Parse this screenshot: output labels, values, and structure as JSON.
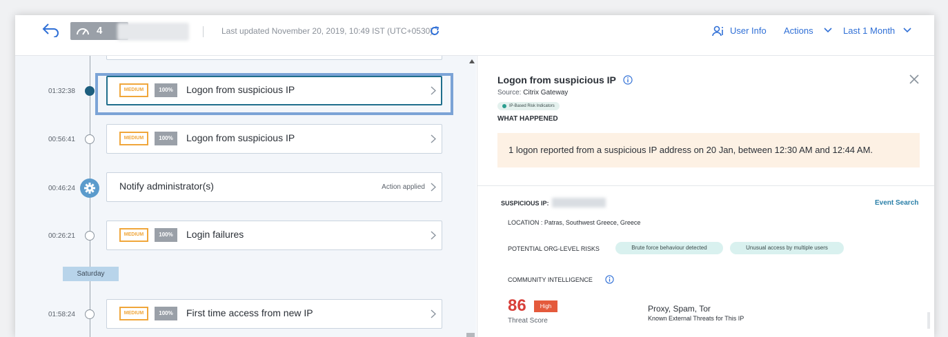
{
  "topbar": {
    "score": "4",
    "last_updated": "Last updated November 20, 2019, 10:49 IST (UTC+0530)",
    "user_info": "User Info",
    "actions": "Actions",
    "time_range": "Last 1 Month"
  },
  "timeline": {
    "events": [
      {
        "time": "01:32:38",
        "severity": "MEDIUM",
        "confidence": "100%",
        "title": "Logon from suspicious IP",
        "selected": true
      },
      {
        "time": "00:56:41",
        "severity": "MEDIUM",
        "confidence": "100%",
        "title": "Logon from suspicious IP"
      },
      {
        "time": "00:46:24",
        "title": "Notify administrator(s)",
        "status": "Action applied"
      },
      {
        "time": "00:26:21",
        "severity": "MEDIUM",
        "confidence": "100%",
        "title": "Login failures"
      },
      {
        "time": "01:58:24",
        "severity": "MEDIUM",
        "confidence": "100%",
        "title": "First time access from new IP"
      }
    ],
    "day_label": "Saturday"
  },
  "detail": {
    "title": "Logon from suspicious IP",
    "source_label": "Source:",
    "source": "Citrix Gateway",
    "tag": "IP-Based Risk Indicators",
    "what_happened": "WHAT HAPPENED",
    "summary": "1 logon reported from a suspicious IP address on 20 Jan, between 12:30 AM and 12:44 AM.",
    "suspicious_ip_label": "SUSPICIOUS IP:",
    "event_search": "Event Search",
    "location": "LOCATION : Patras, Southwest Greece, Greece",
    "risks_label": "POTENTIAL ORG-LEVEL RISKS",
    "risks": [
      "Brute force behaviour detected",
      "Unusual access by multiple users"
    ],
    "community_label": "COMMUNITY INTELLIGENCE",
    "threat_score": "86",
    "threat_level": "High",
    "threat_score_label": "Threat Score",
    "threats": "Proxy, Spam, Tor",
    "threats_label": "Known External Threats for This IP"
  },
  "colors": {
    "accent": "#2f6fd6",
    "medium": "#f0a63a",
    "high": "#e45a3c",
    "score": "#d8403a",
    "alert_bg": "#fdf1e4",
    "selected_outline": "#7ba3d6"
  }
}
